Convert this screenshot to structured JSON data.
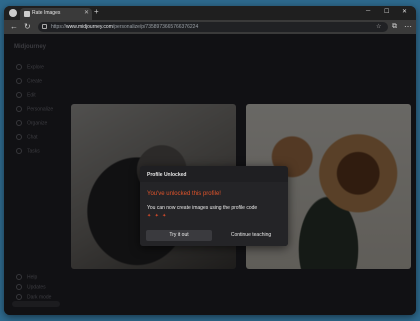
{
  "browser": {
    "tab_title": "Rate Images",
    "url_domain": "www.midjourney.com",
    "url_prefix": "https://",
    "url_path": "/personalize/p/7358973665766376224"
  },
  "sidebar": {
    "logo": "Midjourney",
    "items": [
      {
        "label": "Explore"
      },
      {
        "label": "Create"
      },
      {
        "label": "Edit"
      },
      {
        "label": "Personalize"
      },
      {
        "label": "Organize"
      },
      {
        "label": "Chat"
      },
      {
        "label": "Tasks"
      }
    ],
    "bottom_items": [
      {
        "label": "Help"
      },
      {
        "label": "Updates"
      },
      {
        "label": "Dark mode"
      }
    ]
  },
  "modal": {
    "title": "Profile Unlocked",
    "headline": "You've unlocked this profile!",
    "description": "You can now create images using the profile code",
    "code_hint": "✦ ✦ ✦",
    "try_label": "Try it out",
    "continue_label": "Continue teaching"
  },
  "colors": {
    "accent": "#e0542b",
    "modal_bg": "#1f1f22",
    "page_bg": "#111114"
  }
}
